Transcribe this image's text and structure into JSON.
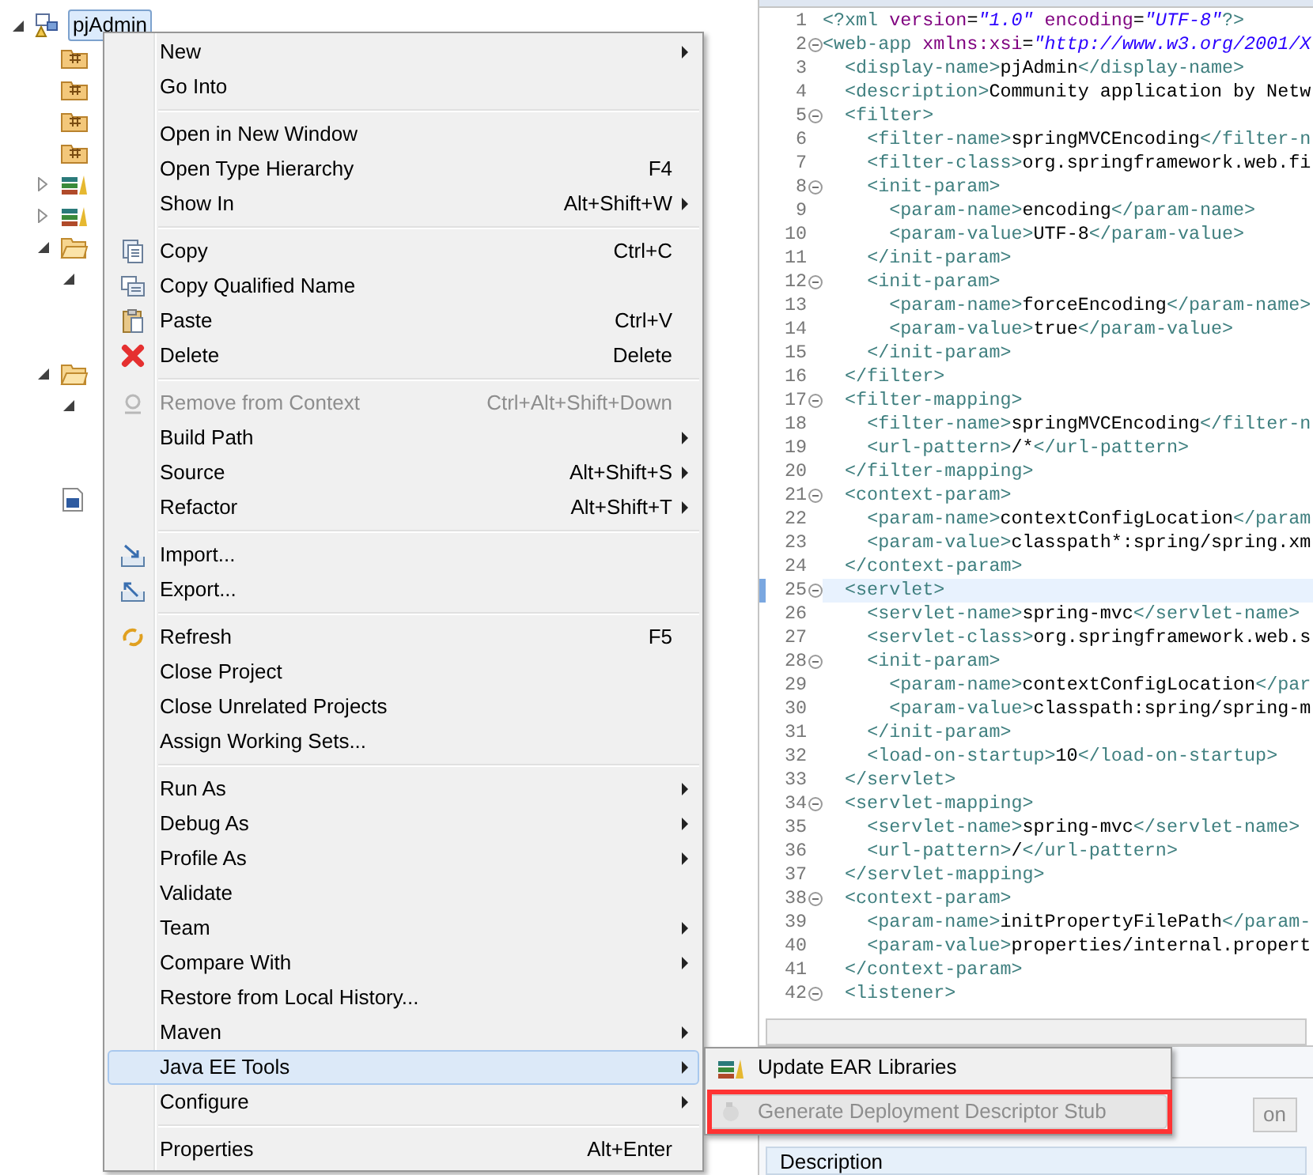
{
  "tree": [
    {
      "label": "pjAdmin",
      "kind": "project",
      "expanded": true,
      "selected": true,
      "children": [
        {
          "kind": "package"
        },
        {
          "kind": "package"
        },
        {
          "kind": "package"
        },
        {
          "kind": "package"
        },
        {
          "kind": "library",
          "expanded": false
        },
        {
          "kind": "library",
          "expanded": false
        },
        {
          "kind": "folder",
          "expanded": true,
          "children": [
            {
              "expanded": true
            }
          ]
        },
        {
          "kind": "folder",
          "expanded": true,
          "children": [
            {
              "expanded": true
            }
          ]
        },
        {
          "kind": "file"
        }
      ]
    }
  ],
  "editor": {
    "lines": [
      {
        "number": "1",
        "text": "<?xml version=\"1.0\" encoding=\"UTF-8\"?>",
        "fold": false,
        "selected": false
      },
      {
        "number": "2",
        "text": "<web-app xmlns:xsi=\"http://www.w3.org/2001/X",
        "fold": true,
        "selected": false
      },
      {
        "number": "3",
        "text": "  <display-name>pjAdmin</display-name>",
        "fold": false,
        "selected": false
      },
      {
        "number": "4",
        "text": "  <description>Community application by Netw",
        "fold": false,
        "selected": false
      },
      {
        "number": "5",
        "text": "  <filter>",
        "fold": true,
        "selected": false
      },
      {
        "number": "6",
        "text": "    <filter-name>springMVCEncoding</filter-n",
        "fold": false,
        "selected": false
      },
      {
        "number": "7",
        "text": "    <filter-class>org.springframework.web.fi",
        "fold": false,
        "selected": false
      },
      {
        "number": "8",
        "text": "    <init-param>",
        "fold": true,
        "selected": false
      },
      {
        "number": "9",
        "text": "      <param-name>encoding</param-name>",
        "fold": false,
        "selected": false
      },
      {
        "number": "10",
        "text": "      <param-value>UTF-8</param-value>",
        "fold": false,
        "selected": false
      },
      {
        "number": "11",
        "text": "    </init-param>",
        "fold": false,
        "selected": false
      },
      {
        "number": "12",
        "text": "    <init-param>",
        "fold": true,
        "selected": false
      },
      {
        "number": "13",
        "text": "      <param-name>forceEncoding</param-name>",
        "fold": false,
        "selected": false
      },
      {
        "number": "14",
        "text": "      <param-value>true</param-value>",
        "fold": false,
        "selected": false
      },
      {
        "number": "15",
        "text": "    </init-param>",
        "fold": false,
        "selected": false
      },
      {
        "number": "16",
        "text": "  </filter>",
        "fold": false,
        "selected": false
      },
      {
        "number": "17",
        "text": "  <filter-mapping>",
        "fold": true,
        "selected": false
      },
      {
        "number": "18",
        "text": "    <filter-name>springMVCEncoding</filter-n",
        "fold": false,
        "selected": false
      },
      {
        "number": "19",
        "text": "    <url-pattern>/*</url-pattern>",
        "fold": false,
        "selected": false
      },
      {
        "number": "20",
        "text": "  </filter-mapping>",
        "fold": false,
        "selected": false
      },
      {
        "number": "21",
        "text": "  <context-param>",
        "fold": true,
        "selected": false
      },
      {
        "number": "22",
        "text": "    <param-name>contextConfigLocation</param",
        "fold": false,
        "selected": false
      },
      {
        "number": "23",
        "text": "    <param-value>classpath*:spring/spring.xm",
        "fold": false,
        "selected": false
      },
      {
        "number": "24",
        "text": "  </context-param>",
        "fold": false,
        "selected": false
      },
      {
        "number": "25",
        "text": "  <servlet>",
        "fold": true,
        "selected": true
      },
      {
        "number": "26",
        "text": "    <servlet-name>spring-mvc</servlet-name>",
        "fold": false,
        "selected": false
      },
      {
        "number": "27",
        "text": "    <servlet-class>org.springframework.web.s",
        "fold": false,
        "selected": false
      },
      {
        "number": "28",
        "text": "    <init-param>",
        "fold": true,
        "selected": false
      },
      {
        "number": "29",
        "text": "      <param-name>contextConfigLocation</par",
        "fold": false,
        "selected": false
      },
      {
        "number": "30",
        "text": "      <param-value>classpath:spring/spring-m",
        "fold": false,
        "selected": false
      },
      {
        "number": "31",
        "text": "    </init-param>",
        "fold": false,
        "selected": false
      },
      {
        "number": "32",
        "text": "    <load-on-startup>10</load-on-startup>",
        "fold": false,
        "selected": false
      },
      {
        "number": "33",
        "text": "  </servlet>",
        "fold": false,
        "selected": false
      },
      {
        "number": "34",
        "text": "  <servlet-mapping>",
        "fold": true,
        "selected": false
      },
      {
        "number": "35",
        "text": "    <servlet-name>spring-mvc</servlet-name>",
        "fold": false,
        "selected": false
      },
      {
        "number": "36",
        "text": "    <url-pattern>/</url-pattern>",
        "fold": false,
        "selected": false
      },
      {
        "number": "37",
        "text": "  </servlet-mapping>",
        "fold": false,
        "selected": false
      },
      {
        "number": "38",
        "text": "  <context-param>",
        "fold": true,
        "selected": false
      },
      {
        "number": "39",
        "text": "    <param-name>initPropertyFilePath</param-",
        "fold": false,
        "selected": false
      },
      {
        "number": "40",
        "text": "    <param-value>properties/internal.propert",
        "fold": false,
        "selected": false
      },
      {
        "number": "41",
        "text": "  </context-param>",
        "fold": false,
        "selected": false
      },
      {
        "number": "42",
        "text": "  <listener>",
        "fold": true,
        "selected": false
      }
    ]
  },
  "bottom_panel": {
    "button": "on",
    "column": "Description"
  },
  "context_menu": {
    "groups": [
      [
        {
          "label": "New",
          "submenu": true,
          "disabled": false,
          "selected": false
        },
        {
          "label": "Go Into",
          "submenu": false,
          "disabled": false,
          "selected": false
        }
      ],
      [
        {
          "label": "Open in New Window",
          "submenu": false,
          "disabled": false,
          "selected": false
        },
        {
          "label": "Open Type Hierarchy",
          "shortcut": "F4",
          "submenu": false,
          "disabled": false,
          "selected": false
        },
        {
          "label": "Show In",
          "shortcut": "Alt+Shift+W",
          "submenu": true,
          "disabled": false,
          "selected": false
        }
      ],
      [
        {
          "label": "Copy",
          "shortcut": "Ctrl+C",
          "kind": "copy",
          "submenu": false,
          "disabled": false,
          "selected": false
        },
        {
          "label": "Copy Qualified Name",
          "kind": "copy-name",
          "submenu": false,
          "disabled": false,
          "selected": false
        },
        {
          "label": "Paste",
          "shortcut": "Ctrl+V",
          "kind": "paste",
          "submenu": false,
          "disabled": false,
          "selected": false
        },
        {
          "label": "Delete",
          "shortcut": "Delete",
          "kind": "delete",
          "submenu": false,
          "disabled": false,
          "selected": false
        }
      ],
      [
        {
          "label": "Remove from Context",
          "shortcut": "Ctrl+Alt+Shift+Down",
          "kind": "remove",
          "submenu": false,
          "disabled": true,
          "selected": false
        },
        {
          "label": "Build Path",
          "submenu": true,
          "disabled": false,
          "selected": false
        },
        {
          "label": "Source",
          "shortcut": "Alt+Shift+S",
          "submenu": true,
          "disabled": false,
          "selected": false
        },
        {
          "label": "Refactor",
          "shortcut": "Alt+Shift+T",
          "submenu": true,
          "disabled": false,
          "selected": false
        }
      ],
      [
        {
          "label": "Import...",
          "kind": "import",
          "submenu": false,
          "disabled": false,
          "selected": false
        },
        {
          "label": "Export...",
          "kind": "export",
          "submenu": false,
          "disabled": false,
          "selected": false
        }
      ],
      [
        {
          "label": "Refresh",
          "shortcut": "F5",
          "kind": "refresh",
          "submenu": false,
          "disabled": false,
          "selected": false
        },
        {
          "label": "Close Project",
          "submenu": false,
          "disabled": false,
          "selected": false
        },
        {
          "label": "Close Unrelated Projects",
          "submenu": false,
          "disabled": false,
          "selected": false
        },
        {
          "label": "Assign Working Sets...",
          "submenu": false,
          "disabled": false,
          "selected": false
        }
      ],
      [
        {
          "label": "Run As",
          "submenu": true,
          "disabled": false,
          "selected": false
        },
        {
          "label": "Debug As",
          "submenu": true,
          "disabled": false,
          "selected": false
        },
        {
          "label": "Profile As",
          "submenu": true,
          "disabled": false,
          "selected": false
        },
        {
          "label": "Validate",
          "submenu": false,
          "disabled": false,
          "selected": false
        },
        {
          "label": "Team",
          "submenu": true,
          "disabled": false,
          "selected": false
        },
        {
          "label": "Compare With",
          "submenu": true,
          "disabled": false,
          "selected": false
        },
        {
          "label": "Restore from Local History...",
          "submenu": false,
          "disabled": false,
          "selected": false
        },
        {
          "label": "Maven",
          "submenu": true,
          "disabled": false,
          "selected": false
        },
        {
          "label": "Java EE Tools",
          "submenu": true,
          "disabled": false,
          "selected": true
        },
        {
          "label": "Configure",
          "submenu": true,
          "disabled": false,
          "selected": false
        }
      ],
      [
        {
          "label": "Properties",
          "shortcut": "Alt+Enter",
          "submenu": false,
          "disabled": false,
          "selected": false
        }
      ]
    ]
  },
  "submenu": {
    "items": [
      {
        "label": "Update EAR Libraries",
        "kind": "library",
        "disabled": false,
        "selected": false,
        "marked": false
      },
      {
        "label": "Generate Deployment Descriptor Stub",
        "kind": "stub",
        "disabled": true,
        "selected": true,
        "marked": true
      }
    ]
  }
}
